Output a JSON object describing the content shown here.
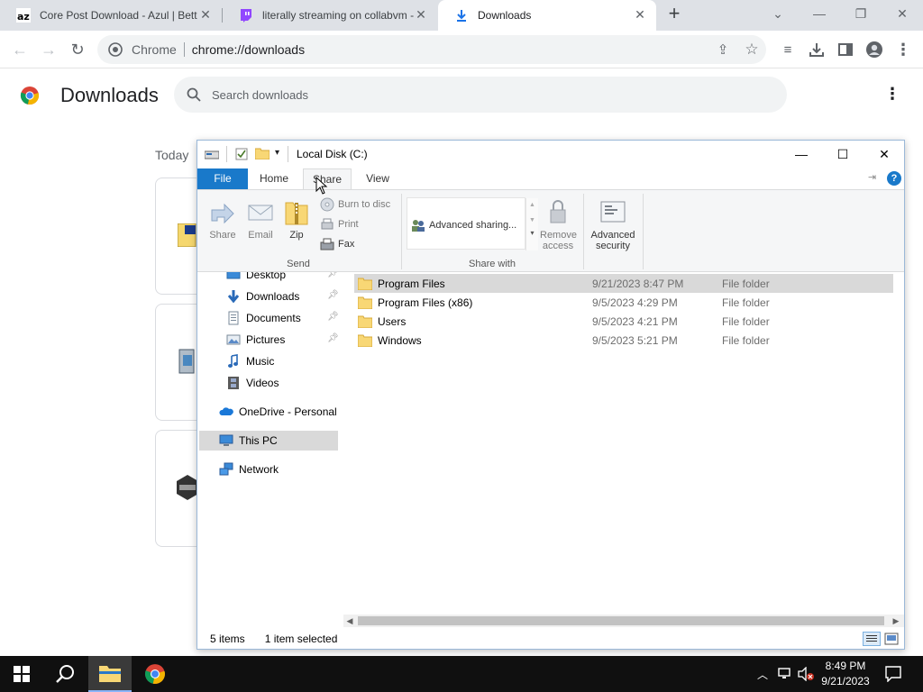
{
  "browser": {
    "tabs": [
      {
        "title": "Core Post Download - Azul | Bett",
        "active": false
      },
      {
        "title": "literally streaming on collabvm -",
        "active": false
      },
      {
        "title": "Downloads",
        "active": true
      }
    ],
    "new_tab": "+",
    "address": {
      "site": "Chrome",
      "url": "chrome://downloads"
    }
  },
  "downloads_page": {
    "title": "Downloads",
    "search_placeholder": "Search downloads",
    "section_today": "Today"
  },
  "explorer": {
    "title": "Local Disk (C:)",
    "ribbon_tabs": [
      "File",
      "Home",
      "Share",
      "View"
    ],
    "active_tab": "Share",
    "ribbon": {
      "send": {
        "share": "Share",
        "email": "Email",
        "zip": "Zip",
        "burn": "Burn to disc",
        "print": "Print",
        "fax": "Fax",
        "group": "Send"
      },
      "share_with": {
        "advanced_sharing": "Advanced sharing...",
        "remove_access_1": "Remove",
        "remove_access_2": "access",
        "advanced_security_1": "Advanced",
        "advanced_security_2": "security",
        "group": "Share with"
      }
    },
    "nav": {
      "desktop": "Desktop",
      "downloads": "Downloads",
      "documents": "Documents",
      "pictures": "Pictures",
      "music": "Music",
      "videos": "Videos",
      "onedrive": "OneDrive - Personal",
      "this_pc": "This PC",
      "network": "Network"
    },
    "files": [
      {
        "name": "Program Files",
        "date": "9/21/2023 8:47 PM",
        "type": "File folder",
        "selected": true
      },
      {
        "name": "Program Files (x86)",
        "date": "9/5/2023 4:29 PM",
        "type": "File folder",
        "selected": false
      },
      {
        "name": "Users",
        "date": "9/5/2023 4:21 PM",
        "type": "File folder",
        "selected": false
      },
      {
        "name": "Windows",
        "date": "9/5/2023 5:21 PM",
        "type": "File folder",
        "selected": false
      }
    ],
    "status": {
      "items": "5 items",
      "selected": "1 item selected"
    }
  },
  "taskbar": {
    "time": "8:49 PM",
    "date": "9/21/2023"
  },
  "colors": {
    "ribbon_file_tab": "#1979ca",
    "folder": "#f8d775",
    "taskbar": "#101010"
  }
}
